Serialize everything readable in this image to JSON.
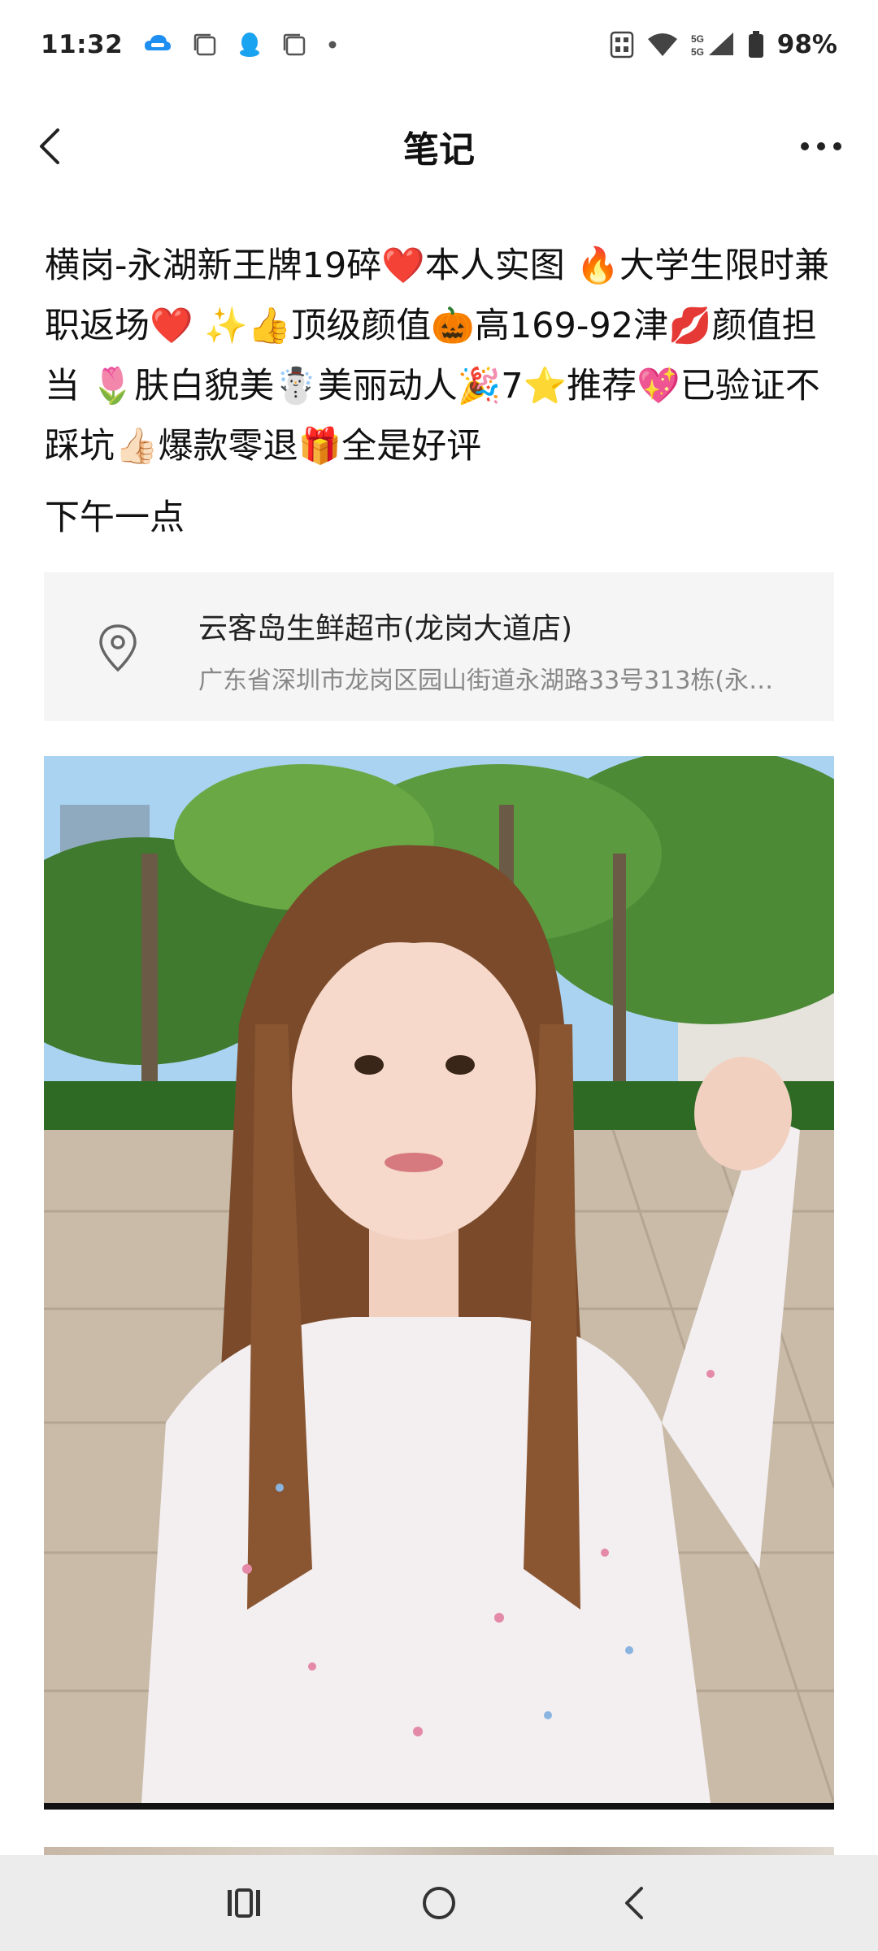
{
  "status_bar": {
    "time": "11:32",
    "notification_icons": [
      "cloud-chat-icon",
      "square-app-icon",
      "penguin-icon",
      "square-app-icon",
      "dot-icon"
    ],
    "network": "5G 5G",
    "battery": "98%"
  },
  "nav": {
    "title": "笔记",
    "back_icon": "chevron-left-icon",
    "more_icon": "more-dots-icon"
  },
  "post": {
    "text": "横岗-永湖新王牌19碎❤️本人实图 🔥大学生限时兼职返场❤️ ✨👍顶级颜值🎃高169-92津💋颜值担当 🌷肤白貌美☃️美丽动人🎉7⭐推荐💖已验证不踩坑👍🏻爆款零退🎁全是好评",
    "time_label": "下午一点"
  },
  "location": {
    "name": "云客岛生鲜超市(龙岗大道店)",
    "address": "广东省深圳市龙岗区园山街道永湖路33号313栋(永…"
  },
  "colors": {
    "sky": "#a9d3f0",
    "foliage": "#3f7a2e",
    "pavement": "#c9bba8",
    "hair": "#7a4a2a",
    "shirt": "#f3eef0"
  },
  "system_nav": {
    "recents_icon": "recents-icon",
    "home_icon": "home-circle-icon",
    "back_icon": "back-chevron-icon"
  }
}
